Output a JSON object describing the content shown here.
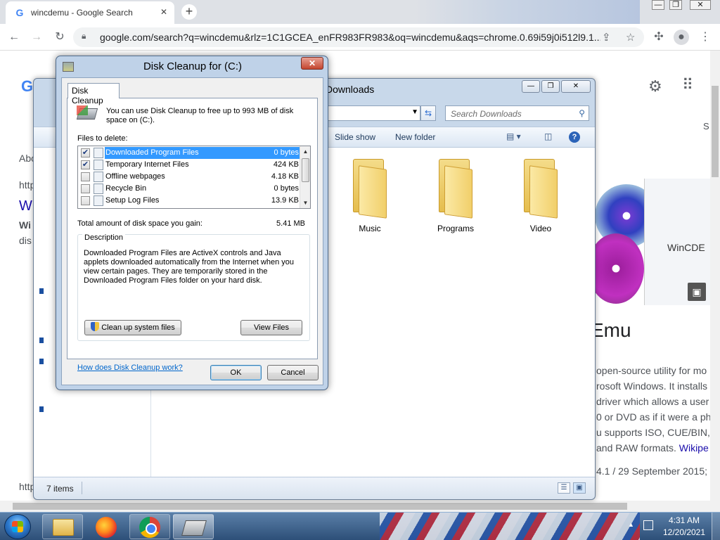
{
  "chrome": {
    "tab_title": "wincdemu - Google Search",
    "tab_close": "✕",
    "new_tab": "+",
    "url": "google.com/search?q=wincdemu&rlz=1C1GCEA_enFR983FR983&oq=wincdemu&aqs=chrome.0.69i59j0i512l9.1...",
    "min": "—",
    "max": "❐",
    "close": "✕"
  },
  "google": {
    "logo": "G",
    "panel_title": "Emu",
    "panel_image_caption": "WinCDE",
    "description_lines": [
      "open-source utility for mo",
      "rosoft Windows. It installs",
      "driver which allows a user",
      "0 or DVD as if it were a ph",
      "u supports ISO, CUE/BIN,"
    ],
    "description_tail": "and RAW formats.",
    "wiki_link": "Wikipe",
    "version_line": "4.1 / 29 September 2015; (",
    "left_fragments": [
      "Abo",
      "http",
      "W",
      "Wi",
      "dis",
      "http"
    ],
    "tab_s": "S"
  },
  "explorer": {
    "title": "Downloads",
    "search_placeholder": "Search Downloads",
    "commands": {
      "slideshow": "Slide show",
      "new_folder": "New folder"
    },
    "folders": [
      {
        "name": "Music"
      },
      {
        "name": "Programs"
      },
      {
        "name": "Video"
      }
    ],
    "status_count": "7 items"
  },
  "dialog": {
    "title": "Disk Cleanup for  (C:)",
    "tab": "Disk Cleanup",
    "intro": "You can use Disk Cleanup to free up to 993 MB of disk space on  (C:).",
    "files_label": "Files to delete:",
    "files": [
      {
        "name": "Downloaded Program Files",
        "size": "0 bytes",
        "checked": true,
        "selected": true
      },
      {
        "name": "Temporary Internet Files",
        "size": "424 KB",
        "checked": true,
        "selected": false
      },
      {
        "name": "Offline webpages",
        "size": "4.18 KB",
        "checked": false,
        "selected": false
      },
      {
        "name": "Recycle Bin",
        "size": "0 bytes",
        "checked": false,
        "selected": false
      },
      {
        "name": "Setup Log Files",
        "size": "13.9 KB",
        "checked": false,
        "selected": false
      }
    ],
    "total_label": "Total amount of disk space you gain:",
    "total_value": "5.41 MB",
    "description_legend": "Description",
    "description": "Downloaded Program Files are ActiveX controls and Java applets downloaded automatically from the Internet when you view certain pages. They are temporarily stored in the Downloaded Program Files folder on your hard disk.",
    "cleanup_button": "Clean up system files",
    "view_files_button": "View Files",
    "help_link": "How does Disk Cleanup work?",
    "ok": "OK",
    "cancel": "Cancel",
    "close": "✕"
  },
  "taskbar": {
    "time": "4:31 AM",
    "date": "12/20/2021"
  }
}
